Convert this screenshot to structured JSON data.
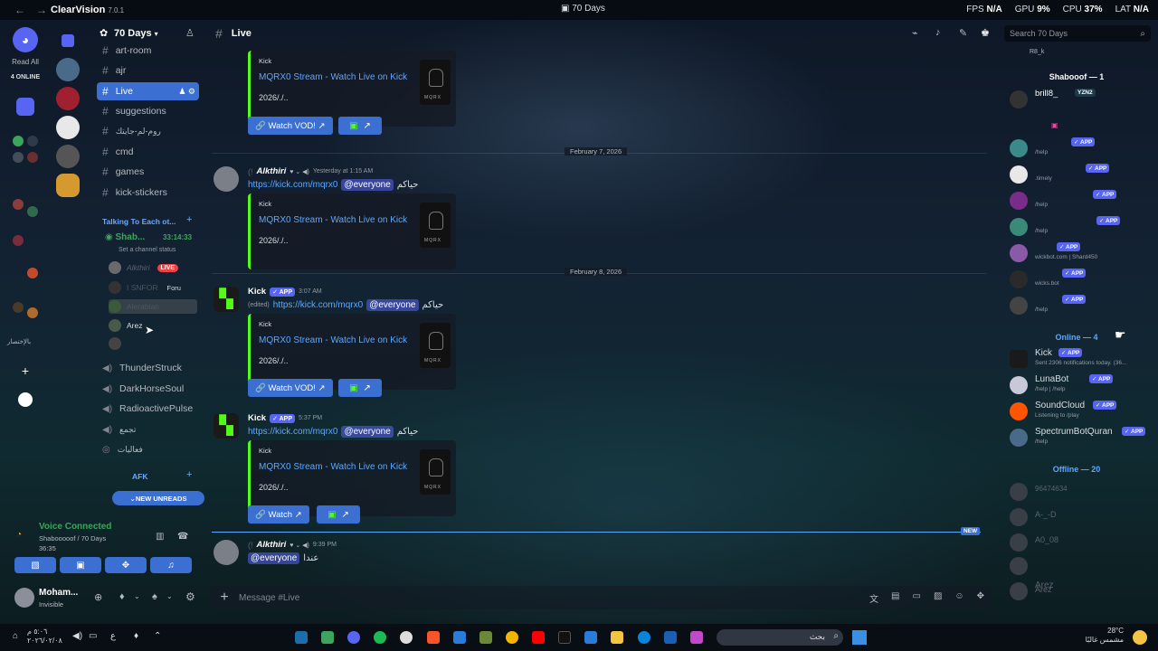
{
  "titlebar": {
    "app": "ClearVision",
    "version": "7.0.1",
    "center": "70 Days",
    "fps_label": "FPS",
    "fps": "N/A",
    "gpu_label": "GPU",
    "gpu": "9%",
    "cpu_label": "CPU",
    "cpu": "37%",
    "lat_label": "LAT",
    "lat": "N/A"
  },
  "rail": {
    "read_all": "Read All",
    "online": "4 ONLINE",
    "ar_label": "بالإختصار"
  },
  "server": {
    "name": "70 Days"
  },
  "channels": {
    "text": [
      "art-room",
      "ajr",
      "Live",
      "suggestions",
      "روم-لم-جايتك",
      "cmd",
      "games",
      "kick-stickers"
    ],
    "category": "Talking To Each ot...",
    "voice_channel": "Shab...",
    "voice_timer": "33:14:33",
    "voice_status": "Set a channel status",
    "voice_users": [
      {
        "name": "Alkthiri",
        "tag": "LIVE"
      },
      {
        "name": "I SNFOR",
        "tag": "Foru"
      },
      {
        "name": "Alerabian"
      },
      {
        "name": "Arez"
      },
      {
        "name": ""
      }
    ],
    "voice": [
      "ThunderStruck",
      "DarkHorseSoul",
      "RadioactivePulse",
      "تجمع",
      "فعاليات"
    ],
    "afk": "AFK",
    "new_unreads": "NEW UNREADS"
  },
  "voicepanel": {
    "title": "Voice Connected",
    "sub": "Shabooooof / 70 Days",
    "time": "36:35"
  },
  "userpanel": {
    "name": "Moham...",
    "status": "Invisible"
  },
  "header": {
    "channel": "Live"
  },
  "search": {
    "placeholder": "Search 70 Days"
  },
  "messages": {
    "embed_provider": "Kick",
    "embed_title": "MQRX0 Stream - Watch Live on Kick",
    "embed_desc": "2026/./..",
    "watch_vod": "Watch VOD!",
    "watch": "Watch",
    "divider1": "February 7, 2026",
    "divider2": "February 8, 2026",
    "msg1": {
      "author": "Alkthiri",
      "time": "Yesterday at 1:15 AM",
      "link": "https://kick.com/mqrx0",
      "mention": "@everyone",
      "text": "حياكم"
    },
    "msg2": {
      "author": "Kick",
      "badge": "✓ APP",
      "time": "3:07 AM",
      "edited": "(edited)",
      "link": "https://kick.com/mqrx0",
      "mention": "@everyone",
      "text": "حياكم"
    },
    "msg3": {
      "author": "Kick",
      "badge": "✓ APP",
      "time": "5:37 PM",
      "link": "https://kick.com/mqrx0",
      "mention": "@everyone",
      "text": "حياكم"
    },
    "msg4": {
      "author": "Alkthiri",
      "time": "9:39 PM",
      "mention": "@everyone",
      "text": "عندا"
    },
    "new_label": "NEW"
  },
  "composer": {
    "placeholder": "Message #Live"
  },
  "members": {
    "top_partial": "R8_k",
    "group1": "Shabooof — 1",
    "user1": {
      "name": "brill8_",
      "badge": "YZN2"
    },
    "bots": [
      {
        "status": "/help"
      },
      {
        "status": ".timely"
      },
      {
        "status": "/help"
      },
      {
        "status": "/help"
      },
      {
        "status": "wickbot.com | Shard450"
      },
      {
        "status": "wicks.bot"
      },
      {
        "status": "/help"
      }
    ],
    "app_badge": "✓ APP",
    "online_group": "Online — 4",
    "online": [
      {
        "name": "Kick",
        "status": "Sent 2306 notifications today. (36..."
      },
      {
        "name": "LunaBot",
        "status": "/help | /help"
      },
      {
        "name": "SoundCloud",
        "status": "Listening to /play"
      },
      {
        "name": "SpectrumBotQuran",
        "status": "/help"
      }
    ],
    "offline_group": "Offline — 20",
    "offline": [
      "96474634",
      "A-_-D",
      "A0_08",
      "",
      "Arez"
    ]
  },
  "taskbar": {
    "time": "٥:٠٦ م",
    "date": "٢٠٢٦/٠٢/٠٨",
    "search": "بحث",
    "temp": "28°C",
    "weather": "مشمس غالبًا"
  },
  "colors": {
    "accent": "#3b6fd1",
    "kick_green": "#53fc18",
    "link": "#5ca8ff",
    "online": "#3ba55d"
  }
}
